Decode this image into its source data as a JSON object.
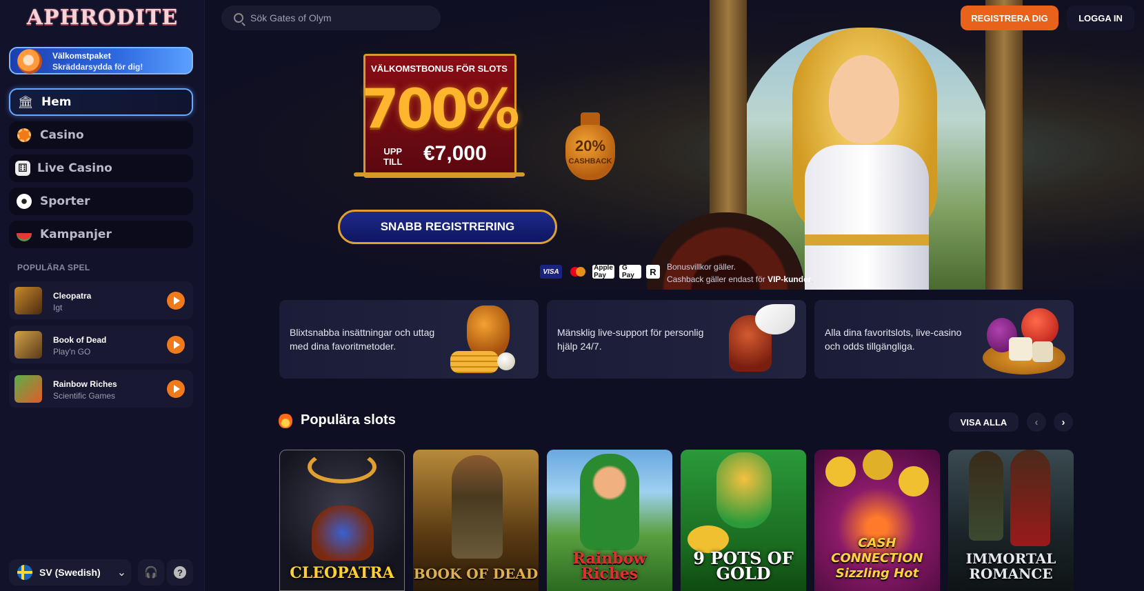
{
  "sidebar": {
    "logo": "APHRODITE",
    "welcome": {
      "title": "Välkomstpaket",
      "subtitle": "Skräddarsydda för dig!"
    },
    "nav": [
      {
        "label": "Hem",
        "icon": "temple-icon"
      },
      {
        "label": "Casino",
        "icon": "chip-icon"
      },
      {
        "label": "Live Casino",
        "icon": "dice-icon"
      },
      {
        "label": "Sporter",
        "icon": "soccer-ball-icon"
      },
      {
        "label": "Kampanjer",
        "icon": "watermelon-icon"
      }
    ],
    "popular_title": "POPULÄRA SPEL",
    "popular_games": [
      {
        "name": "Cleopatra",
        "provider": "Igt"
      },
      {
        "name": "Book of Dead",
        "provider": "Play'n GO"
      },
      {
        "name": "Rainbow Riches",
        "provider": "Scientific Games"
      }
    ],
    "language": "SV (Swedish)"
  },
  "header": {
    "search_placeholder": "Sök Gates of Olym",
    "register": "REGISTRERA DIG",
    "login": "LOGGA IN"
  },
  "hero": {
    "bonus_title": "VÄLKOMSTBONUS FÖR SLOTS",
    "bonus_percent": "700%",
    "bonus_upto_1": "UPP",
    "bonus_upto_2": "TILL",
    "bonus_amount": "€7,000",
    "cashback_percent": "20%",
    "cashback_label": "CASHBACK",
    "cta": "SNABB REGISTRERING",
    "payment_methods": [
      "VISA",
      "Mastercard",
      "Apple Pay",
      "G Pay",
      "R"
    ],
    "terms_line1": "Bonusvillkor gäller.",
    "terms_line2": "Cashback gäller endast för",
    "terms_bold": "VIP-kunder",
    "terms_end": "."
  },
  "features": [
    {
      "text": "Blixtsnabba insättningar och uttag med dina favoritmetoder."
    },
    {
      "text": "Mänsklig live-support för personlig hjälp 24/7."
    },
    {
      "text": "Alla dina favoritslots, live-casino och odds tillgängliga."
    }
  ],
  "popular_slots": {
    "title": "Populära slots",
    "view_all": "VISA ALLA",
    "tiles": [
      {
        "name": "CLEOPATRA"
      },
      {
        "name": "BOOK OF DEAD"
      },
      {
        "name": "Rainbow Riches"
      },
      {
        "name": "9 POTS OF GOLD"
      },
      {
        "name": "CASH CONNECTION Sizzling Hot"
      },
      {
        "name": "IMMORTAL ROMANCE"
      }
    ]
  },
  "colors": {
    "accent": "#e8621c",
    "bg": "#0f0f23",
    "sidebar": "#12122a",
    "active_border": "#6aa8ff"
  }
}
